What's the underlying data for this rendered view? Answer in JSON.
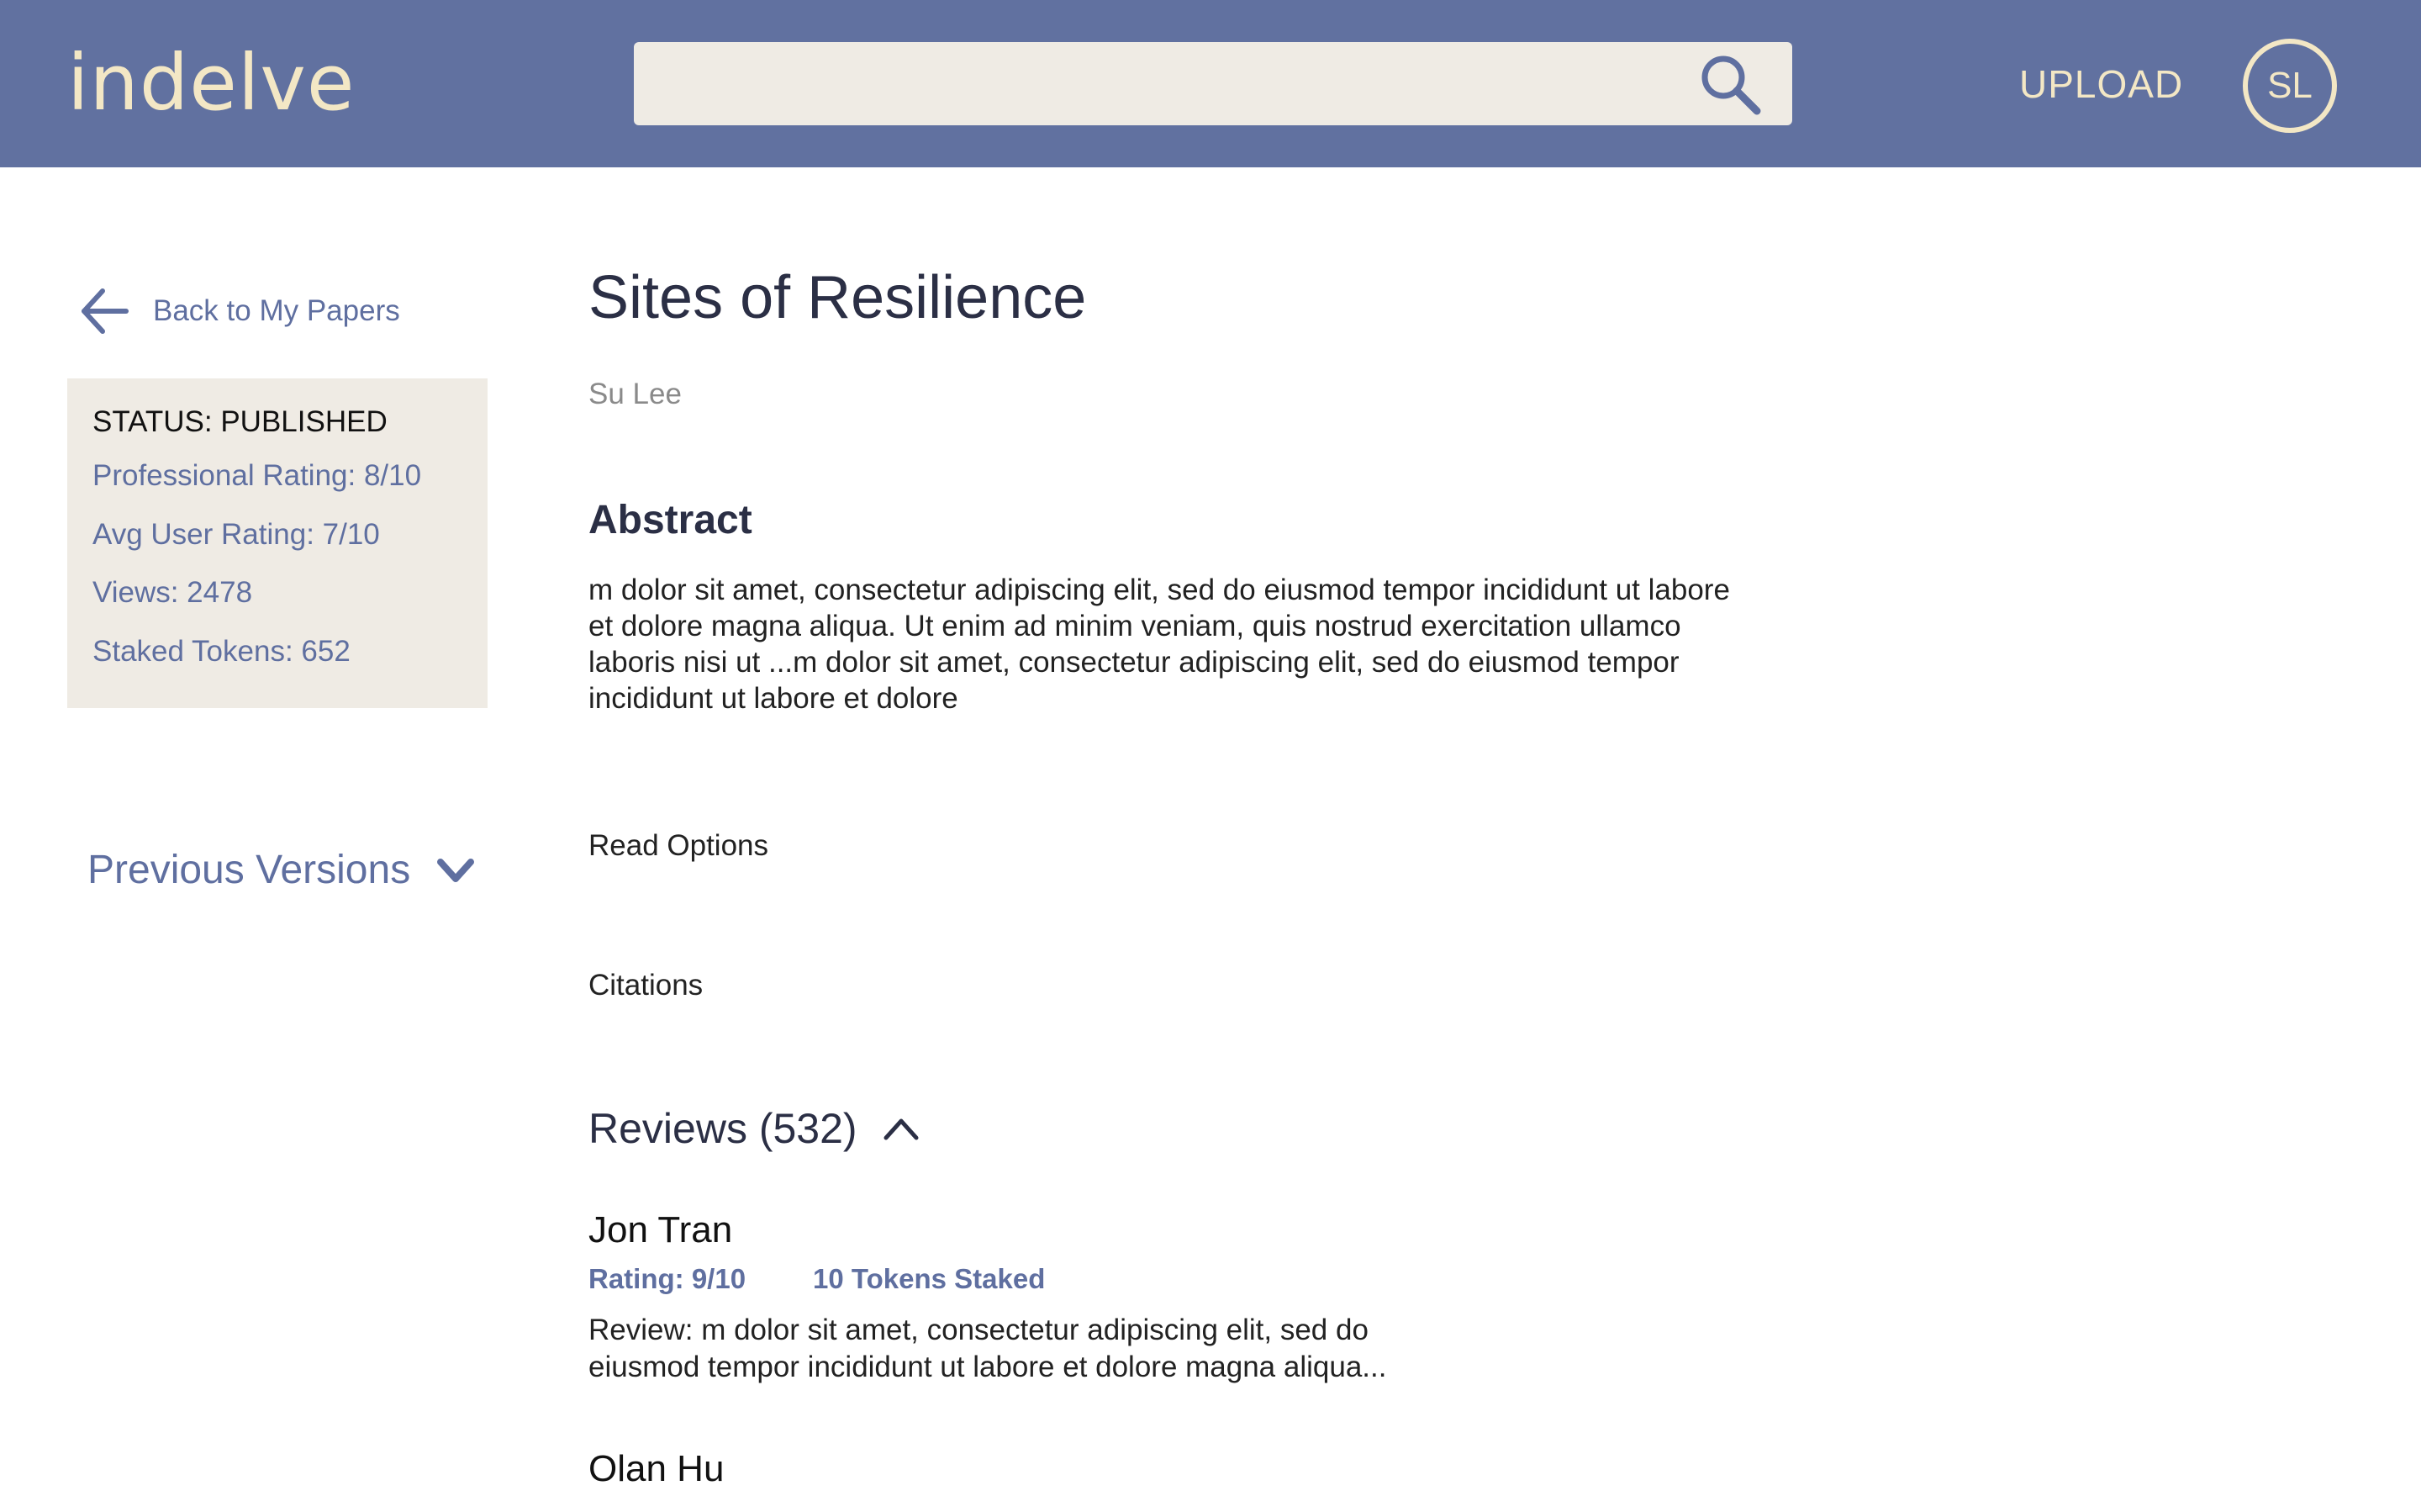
{
  "header": {
    "logo": "indelve",
    "search_placeholder": "",
    "upload_label": "UPLOAD",
    "avatar_initials": "SL"
  },
  "sidebar": {
    "back_label": "Back to My Papers",
    "status": "STATUS: PUBLISHED",
    "professional_rating": "Professional Rating: 8/10",
    "avg_user_rating": "Avg User Rating: 7/10",
    "views": "Views: 2478",
    "staked_tokens": "Staked Tokens: 652",
    "previous_versions_label": "Previous Versions"
  },
  "paper": {
    "title": "Sites of Resilience",
    "author": "Su Lee",
    "abstract_heading": "Abstract",
    "abstract_text": "m dolor sit amet, consectetur adipiscing elit, sed do eiusmod tempor incididunt ut labore et dolore magna aliqua. Ut enim ad minim veniam, quis nostrud exercitation ullamco laboris nisi ut ...m dolor sit amet, consectetur adipiscing elit, sed do eiusmod tempor incididunt ut labore et dolore",
    "read_options_label": "Read Options",
    "citations_label": "Citations",
    "reviews_heading": "Reviews (532)"
  },
  "reviews": [
    {
      "name": "Jon Tran",
      "rating": "Rating: 9/10",
      "tokens": "10 Tokens Staked",
      "body": "Review: m dolor sit amet, consectetur adipiscing elit, sed do eiusmod tempor incididunt ut labore et dolore magna aliqua..."
    },
    {
      "name": "Olan Hu"
    }
  ],
  "colors": {
    "header_bg": "#6171a0",
    "accent_cream": "#f3e7c5",
    "link_blue": "#5f6fa0",
    "panel_bg": "#efebe4"
  },
  "icons": {
    "search": "search-icon",
    "back": "arrow-left-icon",
    "previous_versions": "chevron-down-icon",
    "reviews_toggle": "chevron-up-icon"
  }
}
